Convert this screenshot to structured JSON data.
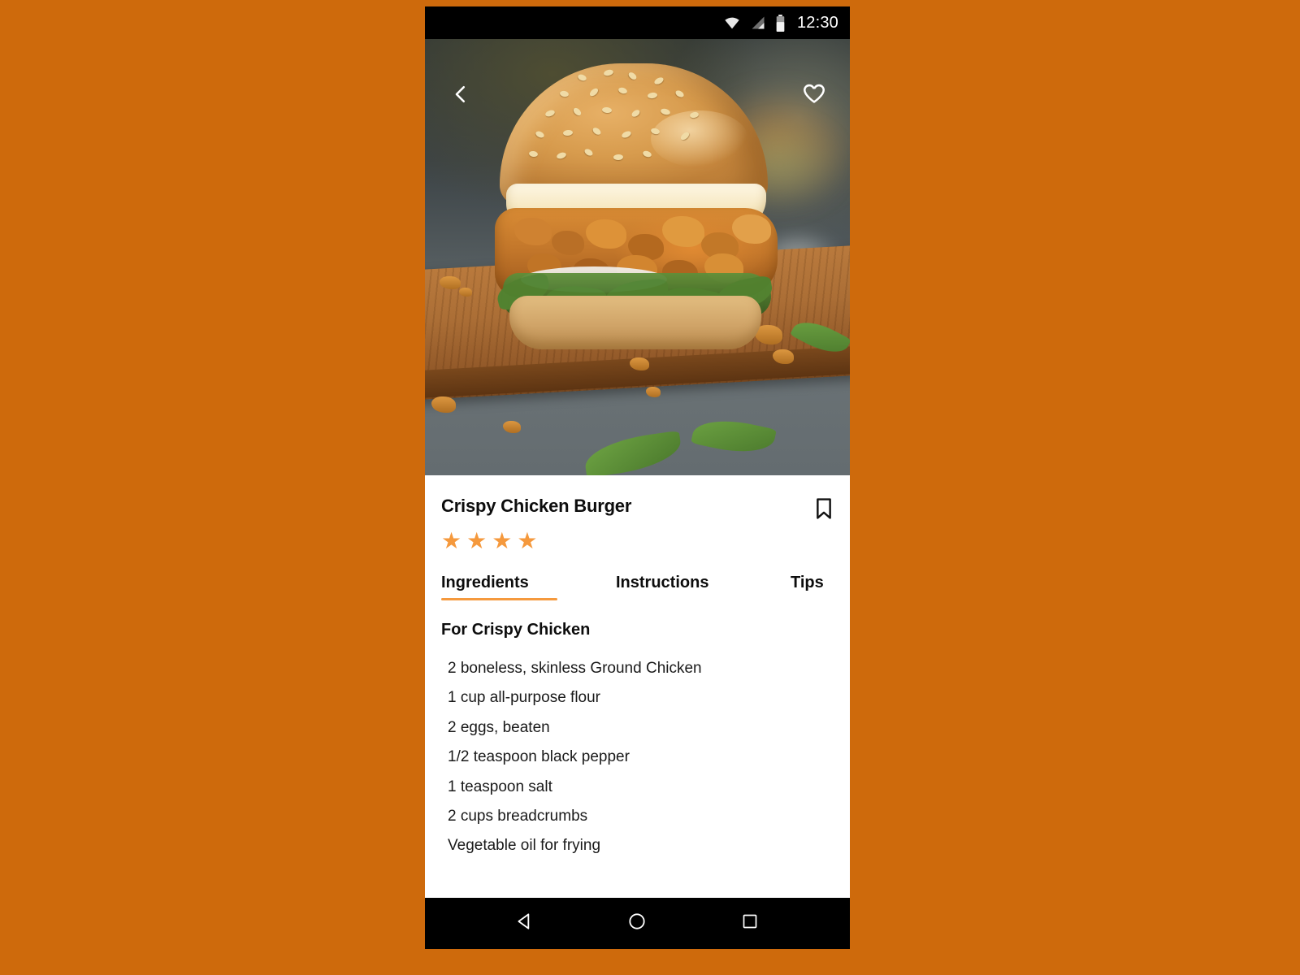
{
  "theme": {
    "page_background": "#CE6A0C",
    "accent": "#F5993D",
    "card_background": "#FFFFFF",
    "system_bar": "#000000",
    "text_primary": "#0D0D0D"
  },
  "status_bar": {
    "time": "12:30",
    "icons": [
      "wifi-icon",
      "cellular-signal-icon",
      "battery-icon"
    ]
  },
  "hero": {
    "photo_alt": "Crispy chicken burger with sesame bun on a wooden cutting board",
    "back_button": "back-chevron-icon",
    "favorite_button": "heart-outline-icon"
  },
  "recipe": {
    "title": "Crispy Chicken Burger",
    "rating_stars": 4,
    "star_glyph": "★",
    "bookmark_icon": "bookmark-outline-icon"
  },
  "tabs": [
    {
      "label": "Ingredients",
      "active": true
    },
    {
      "label": "Instructions",
      "active": false
    },
    {
      "label": "Tips",
      "active": false
    }
  ],
  "ingredients": {
    "section_heading": "For Crispy Chicken",
    "items": [
      "2 boneless, skinless Ground Chicken",
      "1 cup all-purpose flour",
      "2 eggs, beaten",
      "1/2 teaspoon black pepper",
      "1 teaspoon salt",
      "2 cups breadcrumbs",
      "Vegetable oil for frying"
    ]
  },
  "navigation_bar": {
    "back": "back-triangle-icon",
    "home": "home-circle-icon",
    "recents": "recents-square-icon"
  }
}
